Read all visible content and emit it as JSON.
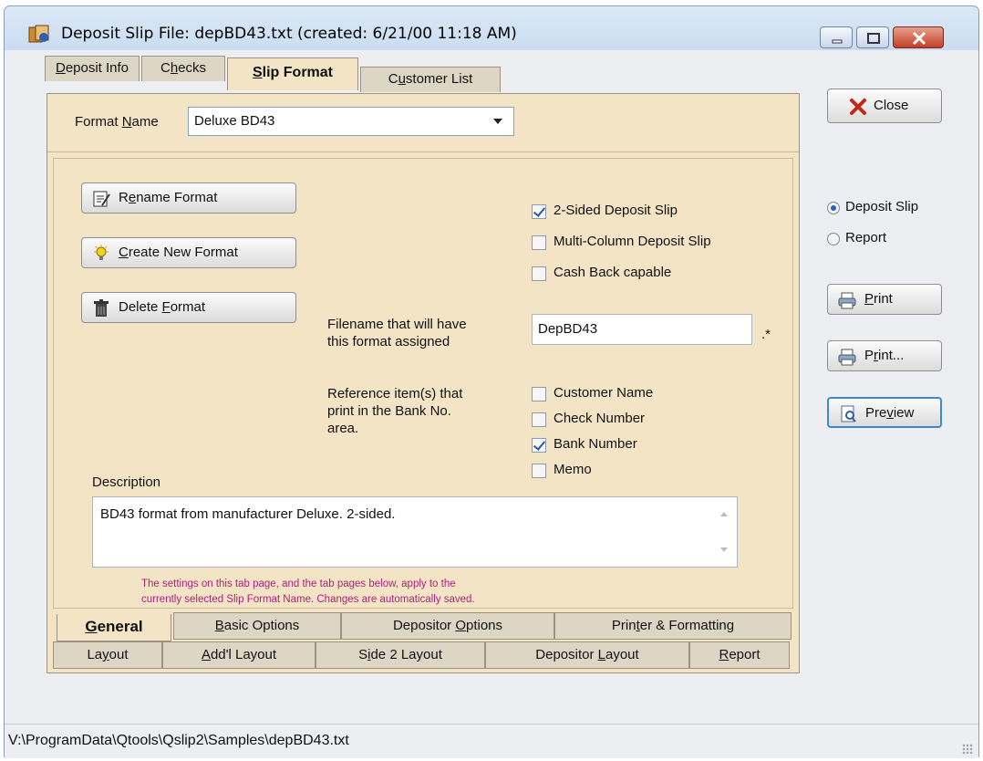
{
  "window": {
    "title": "Deposit Slip File:  depBD43.txt  (created: 6/21/00 11:18 AM)"
  },
  "tabs_top": [
    {
      "label_pre": "",
      "mnemonic": "D",
      "label_post": "eposit Info"
    },
    {
      "label_pre": "C",
      "mnemonic": "h",
      "label_post": "ecks"
    },
    {
      "label_pre": "",
      "mnemonic": "S",
      "label_post": "lip Format"
    },
    {
      "label_pre": "C",
      "mnemonic": "u",
      "label_post": "stomer List"
    }
  ],
  "format": {
    "label_pre": "Format ",
    "label_mn": "N",
    "label_post": "ame",
    "value": "Deluxe BD43"
  },
  "buttons": {
    "rename_pre": "R",
    "rename_mn": "e",
    "rename_post": "name Format",
    "create_pre": "",
    "create_mn": "C",
    "create_post": "reate New Format",
    "delete_pre": "Delete ",
    "delete_mn": "F",
    "delete_post": "ormat"
  },
  "options": {
    "two_sided": {
      "label": "2-Sided Deposit Slip",
      "checked": true
    },
    "multi_column": {
      "label": "Multi-Column Deposit Slip",
      "checked": false
    },
    "cash_back": {
      "label": "Cash Back capable",
      "checked": false
    }
  },
  "filename": {
    "label_line1": "Filename that will have",
    "label_line2": "this format assigned",
    "value": "DepBD43",
    "ext": ".*"
  },
  "reference": {
    "label_line1": "Reference item(s) that",
    "label_line2": "print in the Bank No.",
    "label_line3": "area.",
    "items": [
      {
        "label": "Customer Name",
        "checked": false
      },
      {
        "label": "Check Number",
        "checked": false
      },
      {
        "label": "Bank Number",
        "checked": true
      },
      {
        "label": "Memo",
        "checked": false
      }
    ]
  },
  "description": {
    "label": "Description",
    "value": "BD43 format from manufacturer Deluxe. 2-sided."
  },
  "note": {
    "line1": "The settings on this tab page, and the tab pages below, apply to the",
    "line2": "currently selected Slip Format Name. Changes are automatically saved."
  },
  "subtabs_row1": [
    {
      "pre": "",
      "mn": "G",
      "post": "eneral"
    },
    {
      "pre": "",
      "mn": "B",
      "post": "asic Options"
    },
    {
      "pre": "Depositor ",
      "mn": "O",
      "post": "ptions"
    },
    {
      "pre": "Prin",
      "mn": "t",
      "post": "er & Formatting"
    }
  ],
  "subtabs_row2": [
    {
      "pre": "La",
      "mn": "y",
      "post": "out"
    },
    {
      "pre": "",
      "mn": "A",
      "post": "dd'l Layout"
    },
    {
      "pre": "S",
      "mn": "i",
      "post": "de 2 Layout"
    },
    {
      "pre": "Depositor ",
      "mn": "L",
      "post": "ayout"
    },
    {
      "pre": "",
      "mn": "R",
      "post": "eport"
    }
  ],
  "right": {
    "close_label": "Close",
    "radio_deposit": "Deposit Slip",
    "radio_report": "Report",
    "selected": "Deposit Slip",
    "print_pre": "",
    "print_mn": "P",
    "print_post": "rint",
    "printdlg_pre": "P",
    "printdlg_mn": "r",
    "printdlg_post": "int...",
    "preview_pre": "Pre",
    "preview_mn": "v",
    "preview_post": "iew"
  },
  "statusbar": {
    "path": "V:\\ProgramData\\Qtools\\Qslip2\\Samples\\depBD43.txt"
  }
}
